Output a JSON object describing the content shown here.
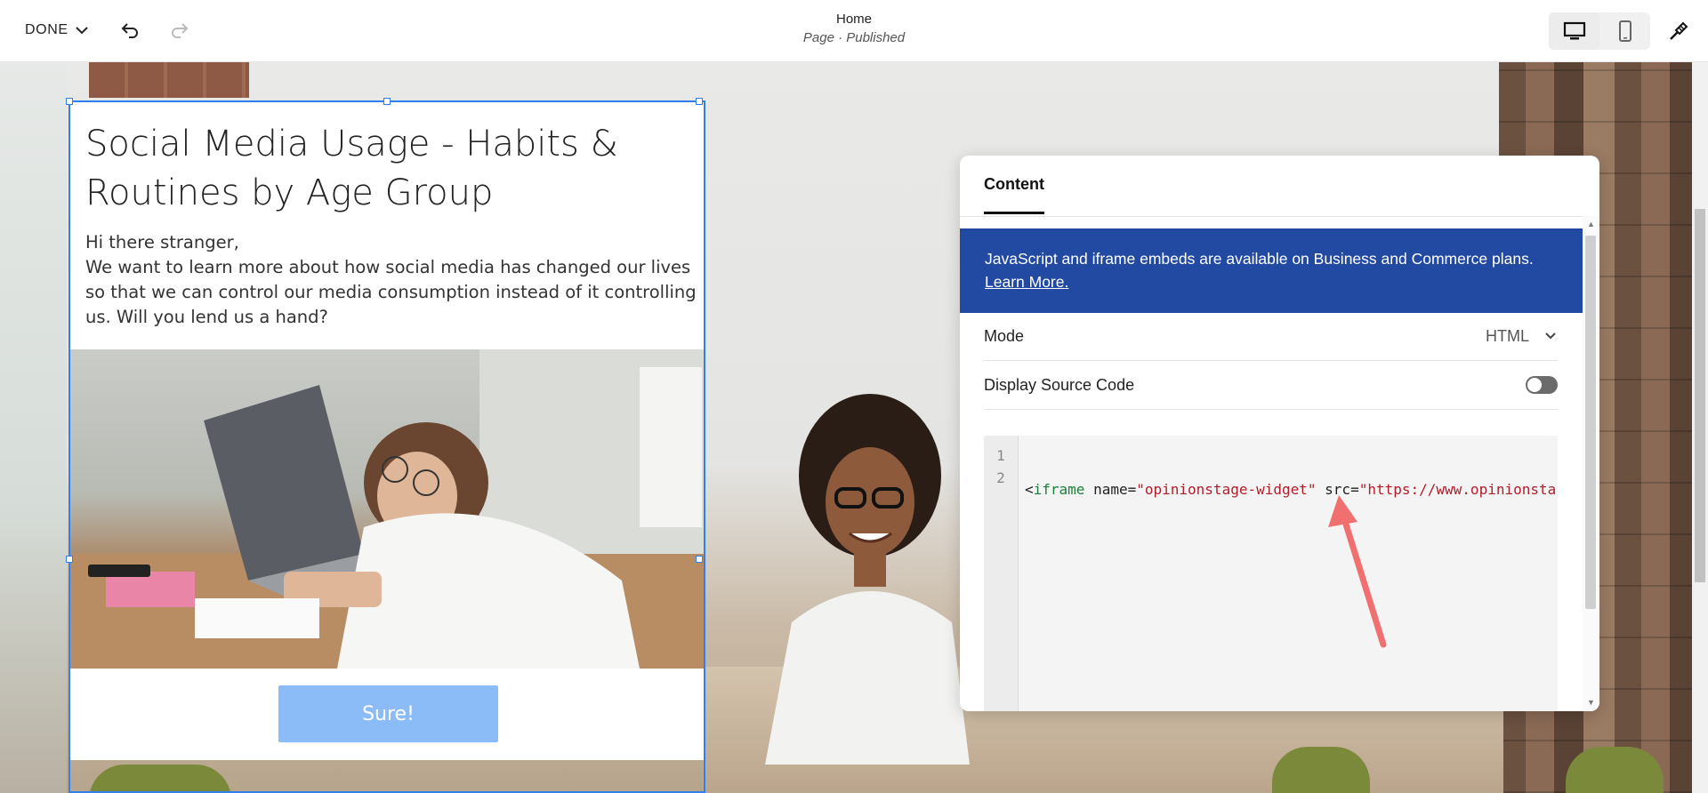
{
  "toolbar": {
    "done_label": "DONE",
    "page_title": "Home",
    "page_status": "Page · Published"
  },
  "block": {
    "title": "Social Media Usage - Habits & Routines by Age Group",
    "body_lines": [
      "Hi there stranger,",
      "We want to learn more about how social media has changed our lives so that we can control our media consumption instead of it controlling us. Will you lend us a hand?"
    ],
    "button_label": "Sure!"
  },
  "panel": {
    "tab_label": "Content",
    "notice_text": "JavaScript and iframe embeds are available on Business and Commerce plans.",
    "notice_link": "Learn More.",
    "mode_label": "Mode",
    "mode_value": "HTML",
    "source_label": "Display Source Code",
    "code": {
      "line_numbers": [
        "1",
        "2"
      ],
      "line1": {
        "open": "<",
        "tag": "iframe",
        "attr1": " name=",
        "val1": "\"opinionstage-widget\"",
        "attr2": " src=",
        "val2": "\"https://www.opinionsta"
      }
    }
  },
  "colors": {
    "accent": "#2f80ed",
    "notice_bg": "#234aa3",
    "button_bg": "#8bbcf7",
    "arrow": "#f07070"
  }
}
